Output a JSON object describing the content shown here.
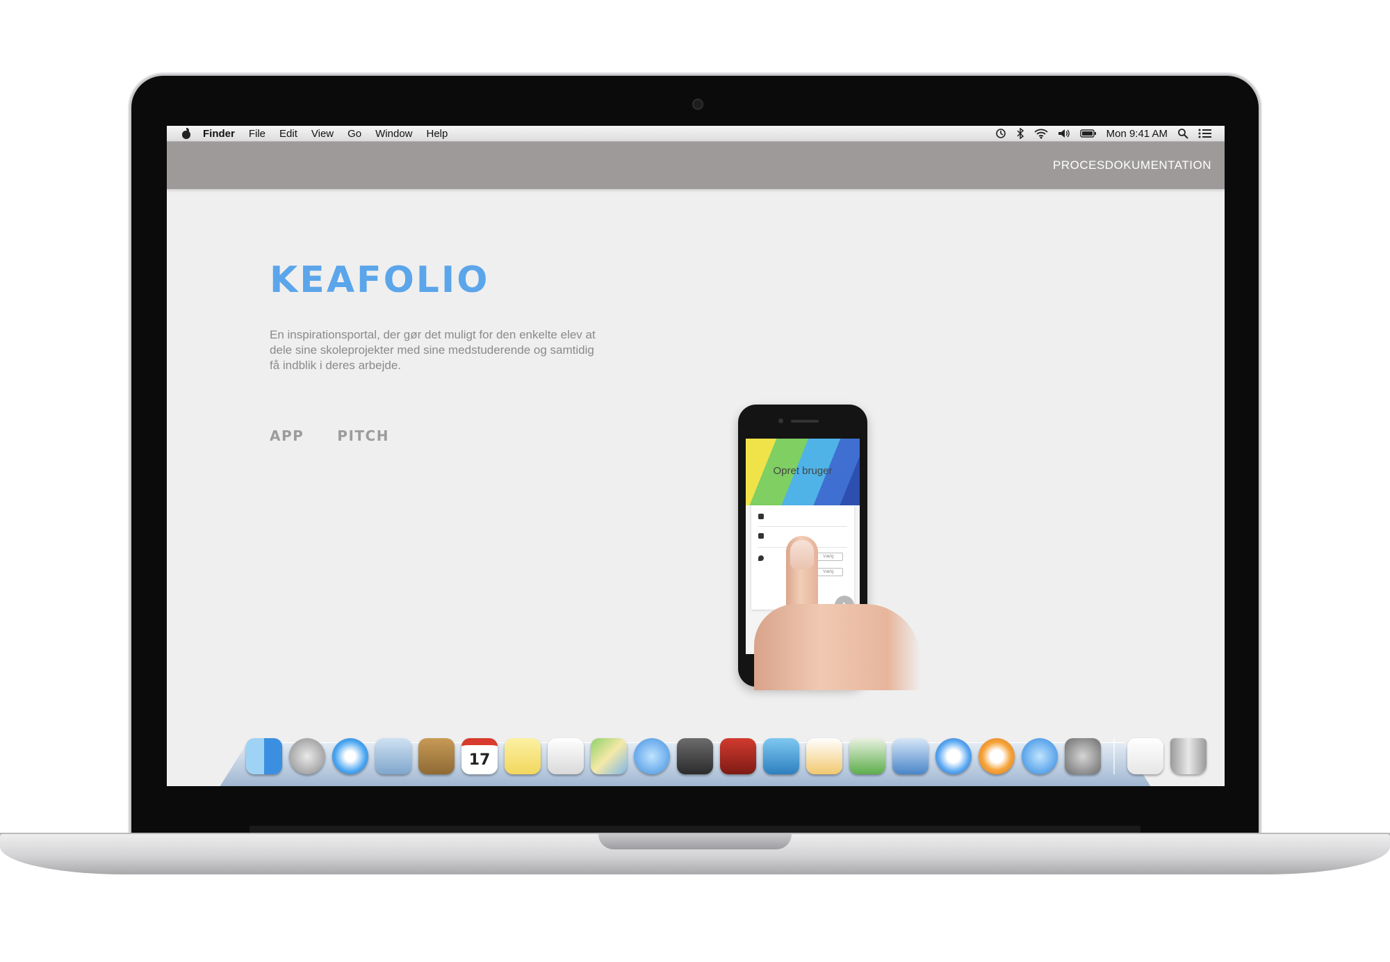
{
  "menubar": {
    "app_name": "Finder",
    "items": [
      "File",
      "Edit",
      "View",
      "Go",
      "Window",
      "Help"
    ],
    "clock": "Mon 9:41 AM",
    "status_icons": [
      "time-machine-icon",
      "bluetooth-icon",
      "wifi-icon",
      "volume-icon",
      "battery-icon",
      "spotlight-icon",
      "notification-center-icon"
    ]
  },
  "site": {
    "nav_link": "PROCESDOKUMENTATION",
    "title": "KEAFOLIO",
    "description": "En inspirationsportal, der gør det muligt for den enkelte elev at dele sine skoleprojekter med sine medstuderende og samtidig få indblik i deres arbejde.",
    "links": [
      "APP",
      "PITCH"
    ],
    "accent_color": "#5ba5ea",
    "header_color": "#9e9a9a"
  },
  "phone": {
    "screen_title": "Opret bruger",
    "field_buttons": [
      "Vælg",
      "Vælg"
    ]
  },
  "dock": {
    "icons": [
      "finder-icon",
      "launchpad-icon",
      "safari-icon",
      "mail-icon",
      "contacts-icon",
      "calendar-icon",
      "notes-icon",
      "reminders-icon",
      "maps-icon",
      "messages-icon",
      "facetime-icon",
      "photo-booth-icon",
      "iphoto-icon",
      "pages-icon",
      "numbers-icon",
      "keynote-icon",
      "itunes-icon",
      "ibooks-icon",
      "app-store-icon",
      "system-preferences-icon",
      "documents-stack-icon",
      "trash-icon"
    ],
    "calendar_day": "17"
  }
}
